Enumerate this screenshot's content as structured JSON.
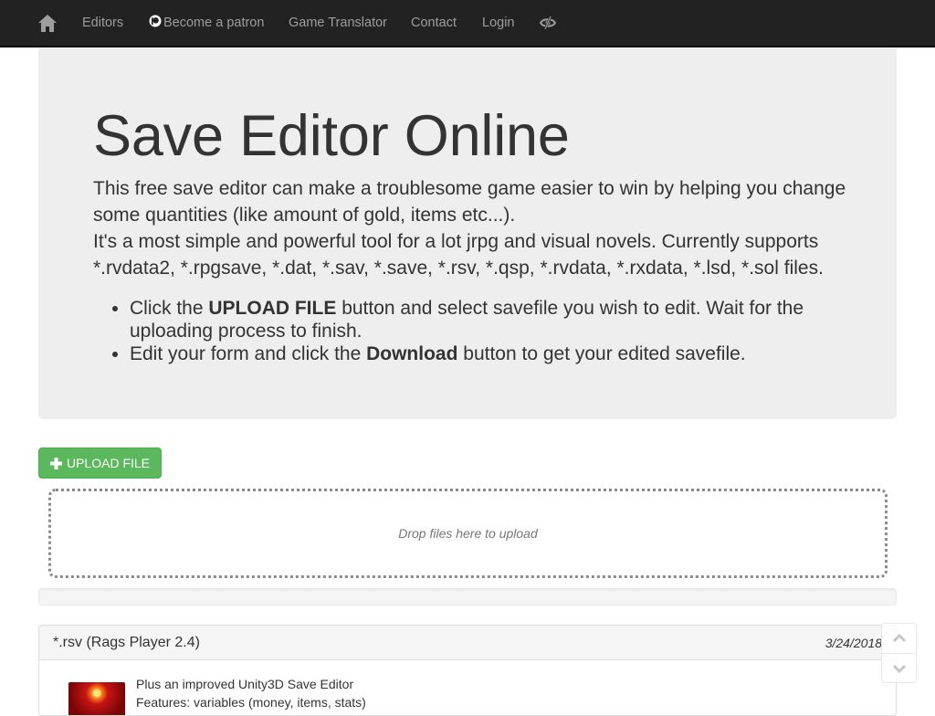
{
  "navbar": {
    "home_icon": "home-icon",
    "links": [
      {
        "label": "Editors"
      },
      {
        "label": "Become a patron",
        "icon": "patreon-icon"
      },
      {
        "label": "Game Translator"
      },
      {
        "label": "Contact"
      },
      {
        "label": "Login"
      }
    ],
    "extra_icon": "eye-slash-icon"
  },
  "hero": {
    "title": "Save Editor Online",
    "lead_line1": "This free save editor can make a troublesome game easier to win by helping you change some quantities (like amount of gold, items etc...).",
    "lead_line2": "It's a most simple and powerful tool for a lot jrpg and visual novels. Currently supports *.rvdata2, *.rpgsave, *.dat, *.sav, *.save, *.rsv, *.qsp, *.rvdata, *.rxdata, *.lsd, *.sol files.",
    "steps": [
      {
        "pre": "Click the ",
        "bold": "UPLOAD FILE",
        "post": " button and select savefile you wish to edit. Wait for the uploading process to finish."
      },
      {
        "pre": "Edit your form and click the ",
        "bold": "Download",
        "post": " button to get your edited savefile."
      }
    ]
  },
  "upload": {
    "button_label": "UPLOAD FILE",
    "button_icon": "plus-icon",
    "dropzone_text": "Drop files here to upload",
    "progress": 0
  },
  "news": {
    "title": "*.rsv (Rags Player 2.4)",
    "date": "3/24/2018",
    "lines": [
      "Plus an improved Unity3D Save Editor",
      "Features: variables (money, items, stats)"
    ]
  },
  "colors": {
    "navbar_bg": "#222222",
    "jumbotron_bg": "#eeeeee",
    "success": "#5cb85c"
  }
}
